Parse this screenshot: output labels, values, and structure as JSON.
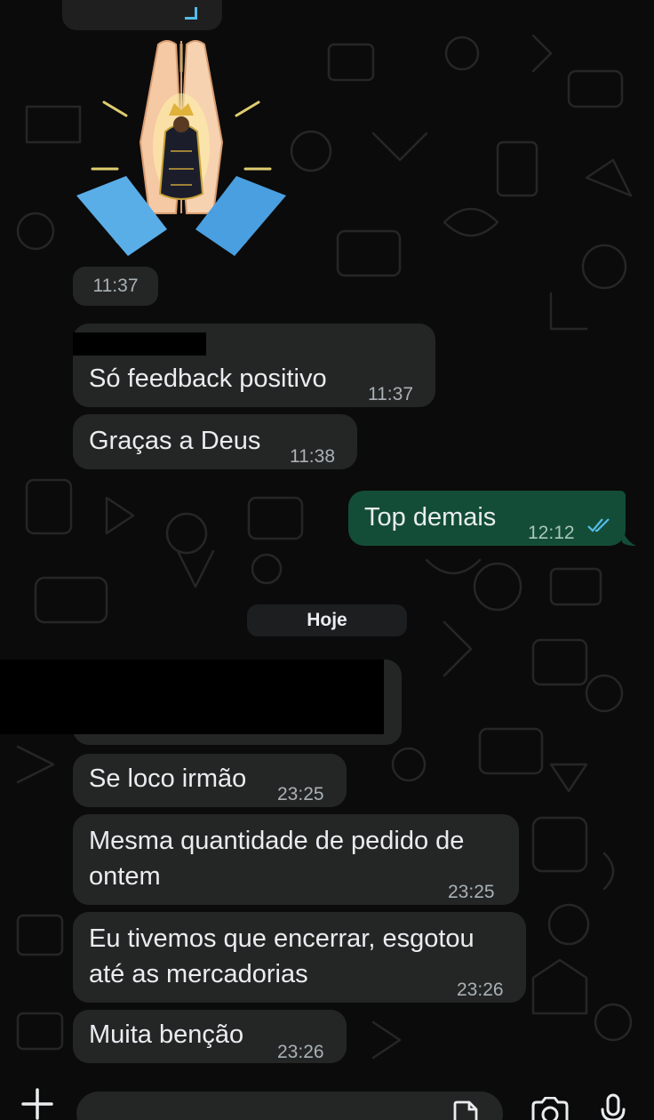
{
  "date_divider": "Hoje",
  "sticker": {
    "time": "11:37"
  },
  "messages": [
    {
      "text": "Só feedback positivo",
      "time": "11:37"
    },
    {
      "text": "Graças a Deus",
      "time": "11:38"
    },
    {
      "text": "Top demais",
      "time": "12:12"
    },
    {
      "text": "Se loco irmão",
      "time": "23:25"
    },
    {
      "lines": [
        "Mesma quantidade de pedido de",
        "ontem"
      ],
      "time": "23:25"
    },
    {
      "lines": [
        "Eu tivemos que encerrar, esgotou",
        "até as mercadorias"
      ],
      "time": "23:26"
    },
    {
      "text": "Muita benção",
      "time": "23:26"
    }
  ],
  "composer": {
    "placeholder": ""
  },
  "colors": {
    "background": "#0b0b0b",
    "incoming_bubble": "#242626",
    "outgoing_bubble": "#144d37",
    "read_ticks": "#53bdeb",
    "timestamp": "#a9b1b5"
  },
  "icons": {
    "attach": "plus-icon",
    "sticker": "sticker-icon",
    "camera": "camera-icon",
    "mic": "mic-icon",
    "read_status": "double-check-icon"
  }
}
